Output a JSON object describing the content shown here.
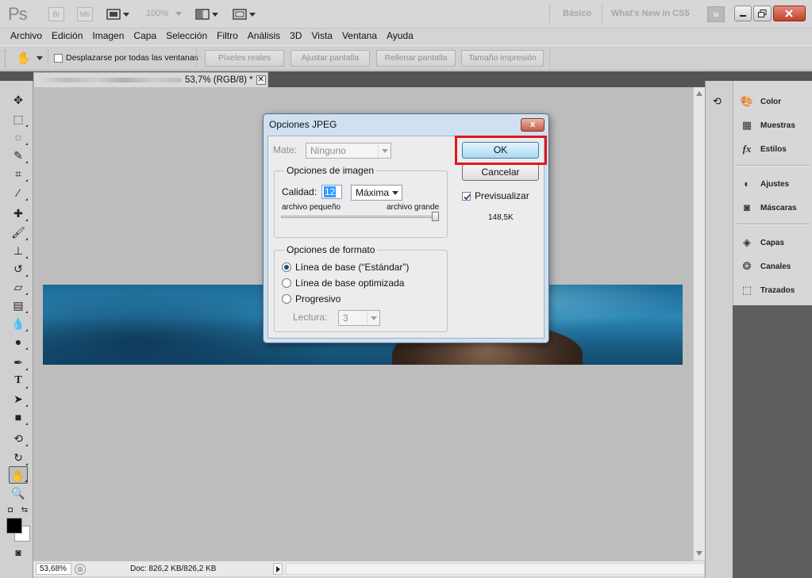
{
  "app": {
    "logo": "Ps",
    "badges": [
      "Br",
      "Mb"
    ],
    "zoom": "100%",
    "workspaces": [
      "Básico",
      "What's New in CS5"
    ],
    "more": "»"
  },
  "menu": [
    "Archivo",
    "Edición",
    "Imagen",
    "Capa",
    "Selección",
    "Filtro",
    "Análisis",
    "3D",
    "Vista",
    "Ventana",
    "Ayuda"
  ],
  "options": {
    "scroll_all": "Desplazarse por todas las ventanas",
    "buttons": [
      "Píxeles reales",
      "Ajustar pantalla",
      "Rellenar pantalla",
      "Tamaño impresión"
    ]
  },
  "document": {
    "tab_title": "53,7% (RGB/8) *",
    "zoom": "53,68%",
    "doc_size": "Doc: 826,2 KB/826,2 KB"
  },
  "panels": [
    "Color",
    "Muestras",
    "Estilos",
    "Ajustes",
    "Máscaras",
    "Capas",
    "Canales",
    "Trazados"
  ],
  "dialog": {
    "title": "Opciones JPEG",
    "close": "x",
    "matte_label": "Mate:",
    "matte_value": "Ninguno",
    "image_group": "Opciones de imagen",
    "quality_label": "Calidad:",
    "quality_value": "12",
    "quality_preset": "Máxima",
    "small_file": "archivo pequeño",
    "large_file": "archivo grande",
    "format_group": "Opciones de formato",
    "format_options": [
      "Línea de base (“Estándar”)",
      "Línea de base optimizada",
      "Progresivo"
    ],
    "format_selected": 0,
    "scans_label": "Lectura:",
    "scans_value": "3",
    "ok": "OK",
    "cancel": "Cancelar",
    "preview_label": "Previsualizar",
    "preview_checked": true,
    "file_size": "148,5K"
  },
  "colors": {
    "ok_highlight": "#e1171e",
    "dialog_frame": "#cfe0f1",
    "close_red": "#c65a44"
  }
}
